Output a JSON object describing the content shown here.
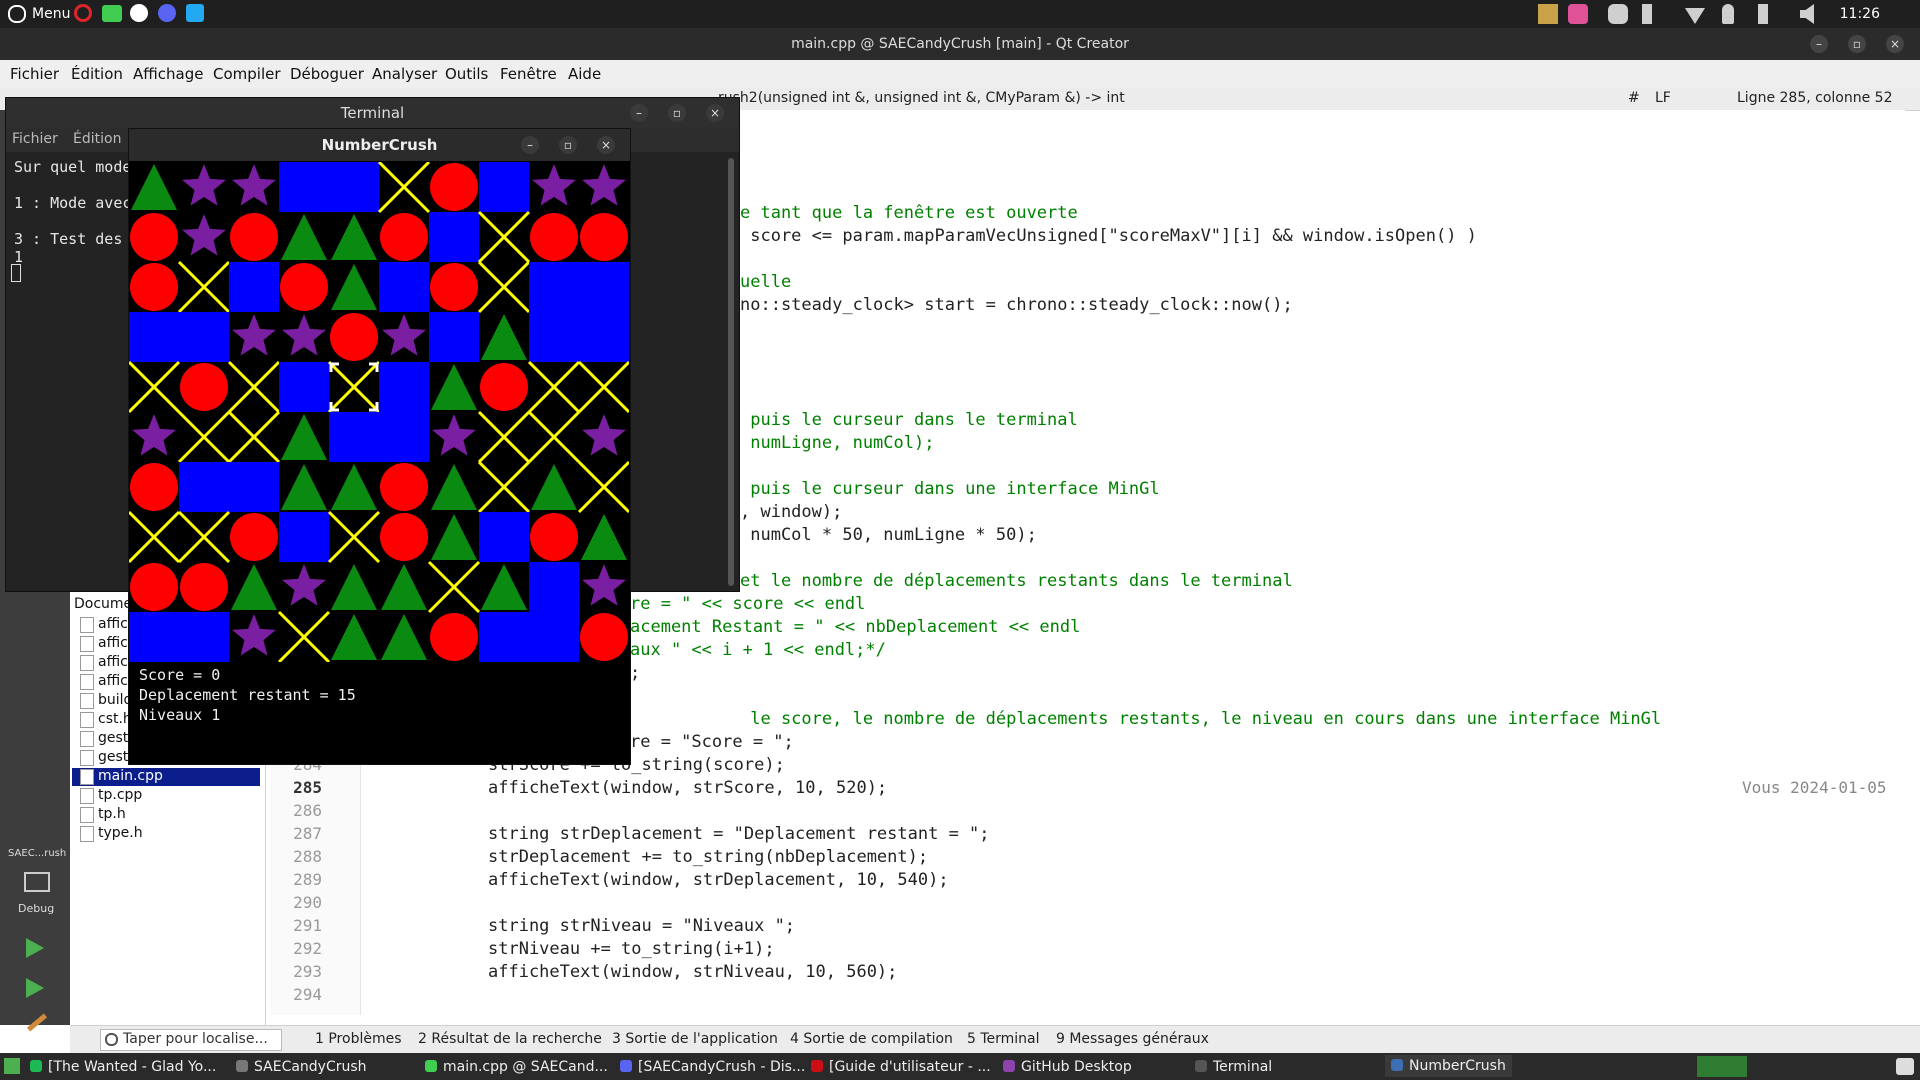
{
  "top_panel": {
    "menu_label": "Menu",
    "clock": "11:26",
    "apps": [
      "opera-icon",
      "qt-creator-icon",
      "github-desktop-icon",
      "discord-icon",
      "vscode-icon"
    ],
    "tray": [
      "monitor-icon",
      "nightlight-icon",
      "discord-tray-icon",
      "bluetooth-icon",
      "wifi-icon",
      "notification-icon",
      "battery-icon",
      "volume-icon"
    ]
  },
  "qt_window": {
    "title": "main.cpp @ SAECandyCrush [main] - Qt Creator",
    "menu": [
      "Fichier",
      "Édition",
      "Affichage",
      "Compiler",
      "Déboguer",
      "Analyser",
      "Outils",
      "Fenêtre",
      "Aide"
    ],
    "toolbar": {
      "function_signature": "rush2(unsigned int &, unsigned int &, CMyParam &) -> int",
      "hash": "#",
      "line_ending": "LF",
      "position": "Ligne 285, colonne 52"
    },
    "project": {
      "header": "Docume",
      "files": [
        "affic",
        "affichage.h",
        "affichagemingl.cpp",
        "affichagemingl.h",
        "build.yaml",
        "cst.h",
        "gestionpartie.cpp",
        "gestionpartie.h",
        "main.cpp",
        "tp.cpp",
        "tp.h",
        "type.h"
      ],
      "selected": "main.cpp"
    },
    "sidebar": {
      "project_name": "SAEC...rush",
      "mode": "Debug"
    },
    "code_lines": [
      {
        "ln": "",
        "text": "e tant que la fenêtre est ouverte",
        "cls": "cm"
      },
      {
        "ln": "",
        "text": " score <= param.mapParamVecUnsigned[\"scoreMaxV\"][i] && window.isOpen() )",
        "cls": ""
      },
      {
        "ln": "",
        "text": "",
        "cls": ""
      },
      {
        "ln": "",
        "text": "uelle",
        "cls": "cm"
      },
      {
        "ln": "",
        "text": "no::steady_clock> start = chrono::steady_clock::now();",
        "cls": ""
      },
      {
        "ln": "",
        "text": "",
        "cls": ""
      },
      {
        "ln": "",
        "text": "",
        "cls": ""
      },
      {
        "ln": "",
        "text": "",
        "cls": ""
      },
      {
        "ln": "",
        "text": "",
        "cls": ""
      },
      {
        "ln": "",
        "text": " puis le curseur dans le terminal",
        "cls": "cm"
      },
      {
        "ln": "",
        "text": " numLigne, numCol);",
        "cls": "cm"
      },
      {
        "ln": "",
        "text": "",
        "cls": ""
      },
      {
        "ln": "",
        "text": " puis le curseur dans une interface MinGl",
        "cls": "cm"
      },
      {
        "ln": "",
        "text": ", window);",
        "cls": ""
      },
      {
        "ln": "",
        "text": " numCol * 50, numLigne * 50);",
        "cls": ""
      },
      {
        "ln": "",
        "text": "",
        "cls": ""
      },
      {
        "ln": "",
        "text": "et le nombre de déplacements restants dans le terminal",
        "cls": "cm"
      },
      {
        "ln": "",
        "text": "re = \" << score << endl",
        "cls": "cm"
      },
      {
        "ln": "",
        "text": "acement Restant = \" << nbDeplacement << endl",
        "cls": "cm"
      },
      {
        "ln": "",
        "text": "aux \" << i + 1 << endl;*/",
        "cls": "cm"
      },
      {
        "ln": "",
        "text": ";",
        "cls": ""
      },
      {
        "ln": "",
        "text": "",
        "cls": ""
      },
      {
        "ln": "",
        "text": " le score, le nombre de déplacements restants, le niveau en cours dans une interface MinGl",
        "cls": "cm"
      },
      {
        "ln": "",
        "text": "re = \"Score = \";",
        "cls": ""
      },
      {
        "ln": "284",
        "text": "strScore += to_string(score);",
        "cls": ""
      },
      {
        "ln": "285",
        "text": "afficheText(window, strScore, 10, 520);",
        "cls": ""
      },
      {
        "ln": "286",
        "text": "",
        "cls": ""
      },
      {
        "ln": "287",
        "text": "string strDeplacement = \"Deplacement restant = \";",
        "cls": ""
      },
      {
        "ln": "288",
        "text": "strDeplacement += to_string(nbDeplacement);",
        "cls": ""
      },
      {
        "ln": "289",
        "text": "afficheText(window, strDeplacement, 10, 540);",
        "cls": ""
      },
      {
        "ln": "290",
        "text": "",
        "cls": ""
      },
      {
        "ln": "291",
        "text": "string strNiveau = \"Niveaux \";",
        "cls": ""
      },
      {
        "ln": "292",
        "text": "strNiveau += to_string(i+1);",
        "cls": ""
      },
      {
        "ln": "293",
        "text": "afficheText(window, strNiveau, 10, 560);",
        "cls": ""
      },
      {
        "ln": "294",
        "text": "",
        "cls": ""
      }
    ],
    "blame": "Vous 2024-01-05",
    "bottom_tabs": [
      "1 Problèmes",
      "2 Résultat de la recherche",
      "3 Sortie de l'application",
      "4 Sortie de compilation",
      "5 Terminal",
      "9 Messages généraux"
    ],
    "locator_placeholder": "Taper pour localise..."
  },
  "terminal": {
    "title": "Terminal",
    "menu": [
      "Fichier",
      "Édition"
    ],
    "lines": [
      "Sur quel mode",
      "",
      "1 : Mode avec",
      "",
      "3 : Test des e",
      "1"
    ]
  },
  "numbercrush": {
    "title": "NumberCrush",
    "grid": [
      [
        "triangle",
        "star",
        "star",
        "square",
        "square",
        "cross",
        "circle",
        "square",
        "star",
        "star"
      ],
      [
        "circle",
        "star",
        "circle",
        "triangle",
        "triangle",
        "circle",
        "square",
        "cross",
        "circle",
        "circle"
      ],
      [
        "circle",
        "cross",
        "square",
        "circle",
        "triangle",
        "square",
        "circle",
        "cross",
        "square",
        "square"
      ],
      [
        "square",
        "square",
        "star",
        "star",
        "circle",
        "star",
        "square",
        "triangle",
        "square",
        "square"
      ],
      [
        "cross",
        "circle",
        "cross",
        "square",
        "cross",
        "square",
        "triangle",
        "circle",
        "cross",
        "cross"
      ],
      [
        "star",
        "cross",
        "cross",
        "triangle",
        "square",
        "square",
        "star",
        "cross",
        "cross",
        "star"
      ],
      [
        "circle",
        "square",
        "square",
        "triangle",
        "triangle",
        "circle",
        "triangle",
        "cross",
        "triangle",
        "cross"
      ],
      [
        "cross",
        "cross",
        "circle",
        "square",
        "cross",
        "circle",
        "triangle",
        "square",
        "circle",
        "triangle"
      ],
      [
        "circle",
        "circle",
        "triangle",
        "star",
        "triangle",
        "triangle",
        "cross",
        "triangle",
        "square",
        "star"
      ],
      [
        "square",
        "square",
        "star",
        "cross",
        "triangle",
        "triangle",
        "circle",
        "square",
        "square",
        "circle"
      ]
    ],
    "selected_cell": [
      4,
      4
    ],
    "score_text": "Score = 0",
    "moves_text": "Deplacement restant = 15",
    "level_text": "Niveaux 1",
    "colors": {
      "triangle": "#0a8a10",
      "star": "#7b1fa2",
      "square": "#0000ff",
      "circle": "#ff0000",
      "cross": "#ffff00",
      "bg": "#000000"
    }
  },
  "taskbar": {
    "items": [
      {
        "label": "[The Wanted - Glad Yo...",
        "color": "#1db954"
      },
      {
        "label": "SAECandyCrush",
        "color": "#777777"
      },
      {
        "label": "main.cpp @ SAECand...",
        "color": "#41cd52"
      },
      {
        "label": "[SAECandyCrush - Dis...",
        "color": "#5865f2"
      },
      {
        "label": "[Guide d'utilisateur - ...",
        "color": "#cc0f16"
      },
      {
        "label": "GitHub Desktop",
        "color": "#8e44ad"
      },
      {
        "label": "Terminal",
        "color": "#555555"
      },
      {
        "label": "NumberCrush",
        "color": "#3d6fb4"
      }
    ]
  }
}
